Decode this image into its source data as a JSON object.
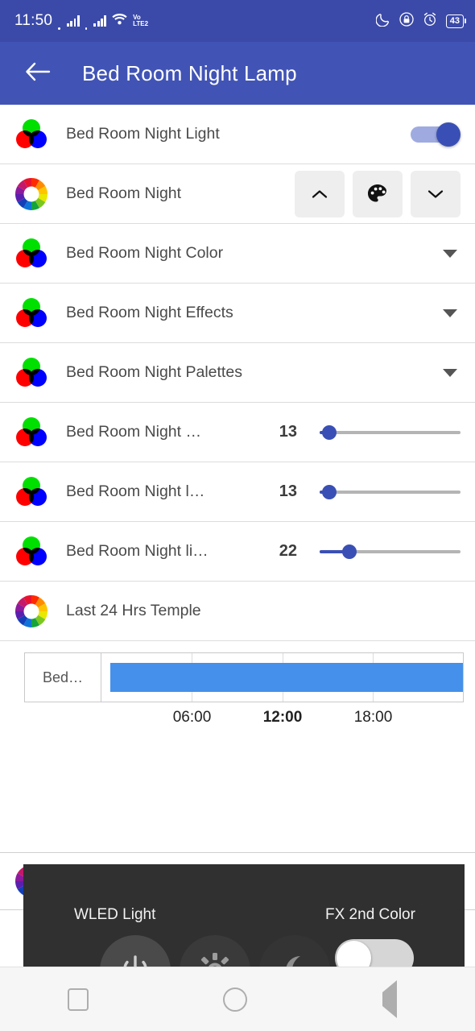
{
  "status_bar": {
    "time": "11:50",
    "network_label_top": "Vo",
    "network_label_bottom": "LTE2",
    "battery": "43",
    "icons": [
      "signal-bars-sim1",
      "signal-bars-sim2",
      "wifi-icon",
      "volte-icon",
      "moon-icon",
      "lock-icon",
      "alarm-icon",
      "battery-icon"
    ]
  },
  "app_bar": {
    "back_label": "←",
    "title": "Bed Room Night Lamp"
  },
  "rows": [
    {
      "label": "Bed Room Night Light",
      "type": "toggle",
      "toggle_on": true,
      "icon": "rgb-venn-icon"
    },
    {
      "label": "Bed Room Night",
      "type": "buttons",
      "icon": "color-wheel-icon",
      "buttons": [
        "chevron-up-icon",
        "palette-icon",
        "chevron-down-icon"
      ]
    },
    {
      "label": "Bed Room Night Color",
      "type": "dropdown",
      "icon": "rgb-venn-icon"
    },
    {
      "label": "Bed Room Night Effects",
      "type": "dropdown",
      "icon": "rgb-venn-icon"
    },
    {
      "label": "Bed Room Night Palettes",
      "type": "dropdown",
      "icon": "rgb-venn-icon"
    },
    {
      "label": "Bed Room Night …",
      "type": "slider",
      "value": "13",
      "percent": 7,
      "icon": "rgb-venn-icon"
    },
    {
      "label": "Bed Room Night l…",
      "type": "slider",
      "value": "13",
      "percent": 7,
      "icon": "rgb-venn-icon"
    },
    {
      "label": "Bed Room Night li…",
      "type": "slider",
      "value": "22",
      "percent": 21,
      "icon": "rgb-venn-icon"
    }
  ],
  "history": {
    "title": "Last 24 Hrs Temple",
    "icon": "color-wheel-icon"
  },
  "chart_data": {
    "type": "bar",
    "title": "Last 24 Hrs Temple",
    "orientation": "horizontal-timeline",
    "categories": [
      "Bed…"
    ],
    "series": [
      {
        "name": "Bed…",
        "start_hour": 0.6,
        "end_hour": 24,
        "value": 23.4,
        "color": "#4490ea"
      }
    ],
    "xlabel": "",
    "ylabel": "",
    "xticks": [
      "06:00",
      "12:00",
      "18:00"
    ],
    "xtick_hours": [
      6,
      12,
      18
    ],
    "xtick_bold": [
      false,
      true,
      false
    ],
    "xlim": [
      0,
      24
    ],
    "grid": true,
    "legend": "none"
  },
  "wheel_row": {
    "icon": "color-wheel-icon",
    "label": ""
  },
  "wled_panel": {
    "title": "WLED Light",
    "fx_label": "FX 2nd Color",
    "fx_toggle_on": false,
    "buttons": [
      "power-icon",
      "gear-icon",
      "moon-icon"
    ]
  },
  "nav_bar": {
    "items": [
      "recents-square-icon",
      "home-circle-icon",
      "back-triangle-icon"
    ]
  },
  "colors": {
    "status_bar": "#3b4aa8",
    "app_bar": "#4154b5",
    "accent": "#3a4fb5",
    "chart_bar": "#4490ea",
    "panel_bg": "#303030"
  }
}
